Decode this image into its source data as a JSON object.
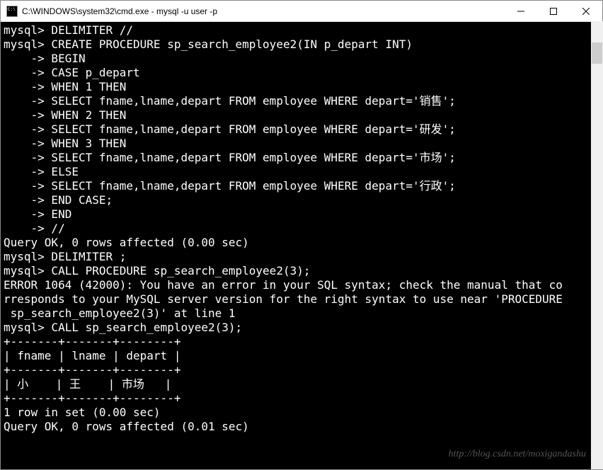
{
  "window": {
    "title": "C:\\WINDOWS\\system32\\cmd.exe - mysql  -u user -p"
  },
  "terminal": {
    "lines": [
      "mysql> DELIMITER //",
      "mysql> CREATE PROCEDURE sp_search_employee2(IN p_depart INT)",
      "    -> BEGIN",
      "    -> CASE p_depart",
      "    -> WHEN 1 THEN",
      "    -> SELECT fname,lname,depart FROM employee WHERE depart='销售';",
      "    -> WHEN 2 THEN",
      "    -> SELECT fname,lname,depart FROM employee WHERE depart='研发';",
      "    -> WHEN 3 THEN",
      "    -> SELECT fname,lname,depart FROM employee WHERE depart='市场';",
      "    -> ELSE",
      "    -> SELECT fname,lname,depart FROM employee WHERE depart='行政';",
      "    -> END CASE;",
      "    -> END",
      "    -> //",
      "Query OK, 0 rows affected (0.00 sec)",
      "",
      "mysql> DELIMITER ;",
      "mysql> CALL PROCEDURE sp_search_employee2(3);",
      "ERROR 1064 (42000): You have an error in your SQL syntax; check the manual that co",
      "rresponds to your MySQL server version for the right syntax to use near 'PROCEDURE",
      " sp_search_employee2(3)' at line 1",
      "mysql> CALL sp_search_employee2(3);",
      "+-------+-------+--------+",
      "| fname | lname | depart |",
      "+-------+-------+--------+",
      "| 小    | 王    | 市场   |",
      "+-------+-------+--------+",
      "1 row in set (0.00 sec)",
      "",
      "Query OK, 0 rows affected (0.01 sec)"
    ]
  },
  "watermark": "http://blog.csdn.net/moxigandashu"
}
